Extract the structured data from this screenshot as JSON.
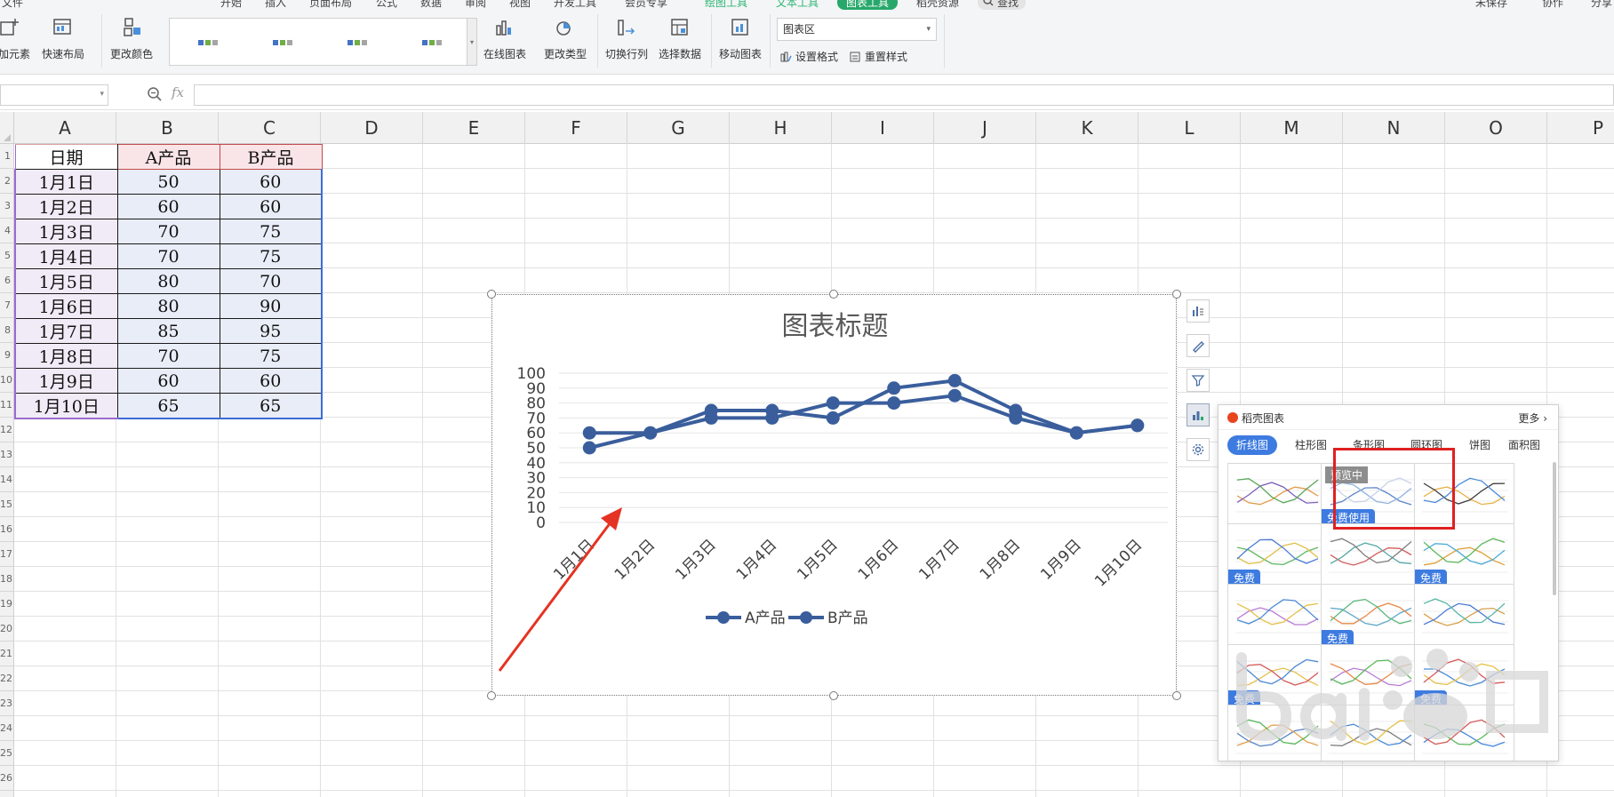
{
  "menu": {
    "file": "文件",
    "start": "开始",
    "insert": "插入",
    "page_layout": "页面布局",
    "formulas": "公式",
    "data": "数据",
    "review": "审阅",
    "view": "视图",
    "developer": "开发工具",
    "member": "会员专享",
    "drawing_tools": "绘图工具",
    "text_tools": "文本工具",
    "chart_tools": "图表工具",
    "docer": "稻壳资源",
    "search": "查找",
    "unsaved": "未保存",
    "collab": "协作",
    "share": "分享"
  },
  "toolbar": {
    "add_element": "添加元素",
    "quick_layout": "快速布局",
    "change_color": "更改颜色",
    "online_chart": "在线图表",
    "change_type": "更改类型",
    "switch_row_col": "切换行列",
    "select_data": "选择数据",
    "move_chart": "移动图表",
    "chart_area_value": "图表区",
    "set_format": "设置格式",
    "reset_style": "重置样式"
  },
  "formula_bar": {
    "fx": "fx",
    "name_box": "",
    "content": ""
  },
  "columns": [
    "A",
    "B",
    "C",
    "D",
    "E",
    "F",
    "G",
    "H",
    "I",
    "J",
    "K",
    "L",
    "M",
    "N",
    "O",
    "P"
  ],
  "row_numbers": [
    "1",
    "2",
    "3",
    "4",
    "5",
    "6",
    "7",
    "8",
    "9",
    "10",
    "11",
    "12",
    "13",
    "14",
    "15",
    "16",
    "17",
    "18",
    "19",
    "20",
    "21",
    "22",
    "23",
    "24",
    "25",
    "26"
  ],
  "table": {
    "headers": [
      "日期",
      "A产品",
      "B产品"
    ],
    "rows": [
      [
        "1月1日",
        "50",
        "60"
      ],
      [
        "1月2日",
        "60",
        "60"
      ],
      [
        "1月3日",
        "70",
        "75"
      ],
      [
        "1月4日",
        "70",
        "75"
      ],
      [
        "1月5日",
        "80",
        "70"
      ],
      [
        "1月6日",
        "80",
        "90"
      ],
      [
        "1月7日",
        "85",
        "95"
      ],
      [
        "1月8日",
        "70",
        "75"
      ],
      [
        "1月9日",
        "60",
        "60"
      ],
      [
        "1月10日",
        "65",
        "65"
      ]
    ]
  },
  "chart_data": {
    "type": "line",
    "title": "图表标题",
    "categories": [
      "1月1日",
      "1月2日",
      "1月3日",
      "1月4日",
      "1月5日",
      "1月6日",
      "1月7日",
      "1月8日",
      "1月9日",
      "1月10日"
    ],
    "series": [
      {
        "name": "A产品",
        "values": [
          50,
          60,
          70,
          70,
          80,
          80,
          85,
          70,
          60,
          65
        ]
      },
      {
        "name": "B产品",
        "values": [
          60,
          60,
          75,
          75,
          70,
          90,
          95,
          75,
          60,
          65
        ]
      }
    ],
    "ylim": [
      0,
      100
    ],
    "yticks": [
      0,
      10,
      20,
      30,
      40,
      50,
      60,
      70,
      80,
      90,
      100
    ],
    "grid": true,
    "legend": "bottom",
    "colors": {
      "series": "#3a5e9c",
      "grid": "#e6e6e6",
      "title": "#595959"
    }
  },
  "panel": {
    "title": "稻壳图表",
    "more": "更多",
    "tabs": [
      "折线图",
      "柱形图",
      "条形图",
      "圆环图",
      "饼图",
      "面积图"
    ],
    "preview_badge": "预览中",
    "free_use": "免费使用",
    "free": "免费"
  },
  "colors": {
    "accent": "#3d7be0",
    "highlight": "#e02020",
    "ribbon_green": "#27a86a",
    "arrow": "#e53323"
  }
}
